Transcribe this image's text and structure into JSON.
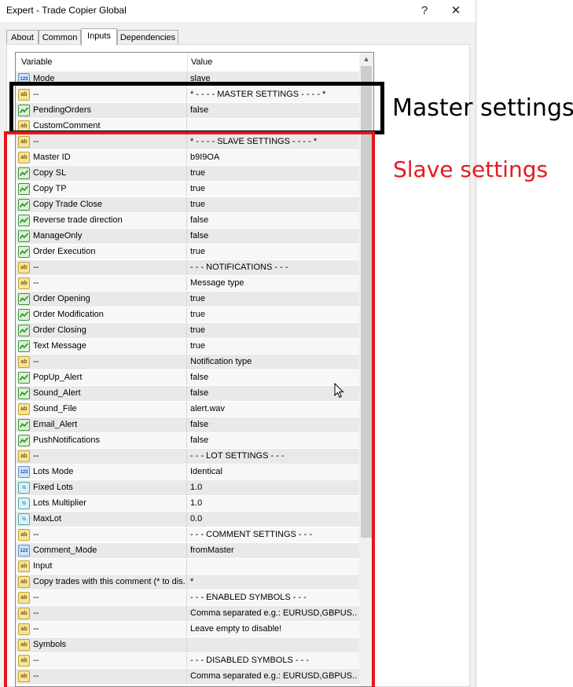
{
  "window": {
    "title": "Expert - Trade Copier Global",
    "help_label": "?",
    "close_label": "✕"
  },
  "tabs": [
    {
      "label": "About",
      "active": false
    },
    {
      "label": "Common",
      "active": false
    },
    {
      "label": "Inputs",
      "active": true
    },
    {
      "label": "Dependencies",
      "active": false
    }
  ],
  "grid": {
    "headers": {
      "variable": "Variable",
      "value": "Value"
    },
    "rows": [
      {
        "type": "int",
        "variable": "Mode",
        "value": "slave"
      },
      {
        "type": "string",
        "variable": "--",
        "value": "* - - - - MASTER SETTINGS - - - - *"
      },
      {
        "type": "bool",
        "variable": "PendingOrders",
        "value": "false"
      },
      {
        "type": "string",
        "variable": "CustomComment",
        "value": ""
      },
      {
        "type": "string",
        "variable": "--",
        "value": "* - - - - SLAVE SETTINGS - - - - *"
      },
      {
        "type": "string",
        "variable": "Master ID",
        "value": "b9I9OA"
      },
      {
        "type": "bool",
        "variable": "Copy SL",
        "value": "true"
      },
      {
        "type": "bool",
        "variable": "Copy TP",
        "value": "true"
      },
      {
        "type": "bool",
        "variable": "Copy Trade Close",
        "value": "true"
      },
      {
        "type": "bool",
        "variable": "Reverse trade direction",
        "value": "false"
      },
      {
        "type": "bool",
        "variable": "ManageOnly",
        "value": "false"
      },
      {
        "type": "bool",
        "variable": "Order Execution",
        "value": "true"
      },
      {
        "type": "string",
        "variable": "--",
        "value": "- - - NOTIFICATIONS - - -"
      },
      {
        "type": "string",
        "variable": "--",
        "value": "Message type"
      },
      {
        "type": "bool",
        "variable": "Order Opening",
        "value": "true"
      },
      {
        "type": "bool",
        "variable": "Order Modification",
        "value": "true"
      },
      {
        "type": "bool",
        "variable": "Order Closing",
        "value": "true"
      },
      {
        "type": "bool",
        "variable": "Text Message",
        "value": "true"
      },
      {
        "type": "string",
        "variable": "--",
        "value": "Notification type"
      },
      {
        "type": "bool",
        "variable": "PopUp_Alert",
        "value": "false"
      },
      {
        "type": "bool",
        "variable": "Sound_Alert",
        "value": "false"
      },
      {
        "type": "string",
        "variable": "Sound_File",
        "value": "alert.wav"
      },
      {
        "type": "bool",
        "variable": "Email_Alert",
        "value": "false"
      },
      {
        "type": "bool",
        "variable": "PushNotifications",
        "value": "false"
      },
      {
        "type": "string",
        "variable": "--",
        "value": "- - - LOT SETTINGS - - -"
      },
      {
        "type": "int",
        "variable": "Lots Mode",
        "value": "Identical"
      },
      {
        "type": "double",
        "variable": "Fixed Lots",
        "value": "1.0"
      },
      {
        "type": "double",
        "variable": "Lots Multiplier",
        "value": "1.0"
      },
      {
        "type": "double",
        "variable": "MaxLot",
        "value": "0.0"
      },
      {
        "type": "string",
        "variable": "--",
        "value": "- - - COMMENT SETTINGS - - -"
      },
      {
        "type": "int",
        "variable": "Comment_Mode",
        "value": "fromMaster"
      },
      {
        "type": "string",
        "variable": "Input",
        "value": ""
      },
      {
        "type": "string",
        "variable": "Copy trades with this comment (* to dis...",
        "value": "*"
      },
      {
        "type": "string",
        "variable": "--",
        "value": "- - - ENABLED SYMBOLS - - -"
      },
      {
        "type": "string",
        "variable": "--",
        "value": "Comma separated e.g.: EURUSD,GBPUS..."
      },
      {
        "type": "string",
        "variable": "--",
        "value": "Leave empty to disable!"
      },
      {
        "type": "string",
        "variable": "Symbols",
        "value": ""
      },
      {
        "type": "string",
        "variable": "--",
        "value": "- - - DISABLED SYMBOLS - - -"
      },
      {
        "type": "string",
        "variable": "--",
        "value": "Comma separated e.g.: EURUSD,GBPUS..."
      }
    ]
  },
  "annotations": {
    "master_label": "Master settings",
    "slave_label": "Slave settings",
    "master_color": "#000000",
    "slave_color": "#e8141b"
  },
  "icons": {
    "string": "ab",
    "int": "123",
    "double": "½",
    "bool": "toggle-icon"
  }
}
